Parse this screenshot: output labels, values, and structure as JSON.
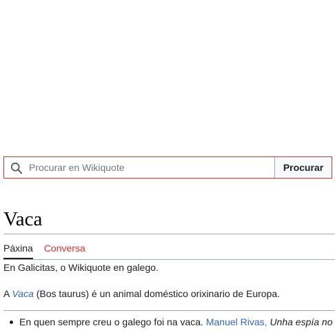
{
  "search": {
    "placeholder": "Procurar en Wikiquote",
    "button_label": "Procurar"
  },
  "article": {
    "title": "Vaca",
    "tabs": [
      {
        "label": "Páxina",
        "active": true
      },
      {
        "label": "Conversa",
        "active": false
      }
    ],
    "subtitle": "En Galicitas, o Wikiquote en galego.",
    "lead": {
      "prefix": "A ",
      "link": "Vaca",
      "suffix": " (Bos taurus) é un animal doméstico orixinario de Europa."
    },
    "quotes": [
      {
        "text": "En quen sempre creu o galego foi na vaca.",
        "author": "Manuel Rivas,",
        "source": "Unha espía no"
      }
    ]
  },
  "colors": {
    "link": "#3366cc",
    "talk_tab": "#d73333",
    "search_border": "#d73333"
  }
}
